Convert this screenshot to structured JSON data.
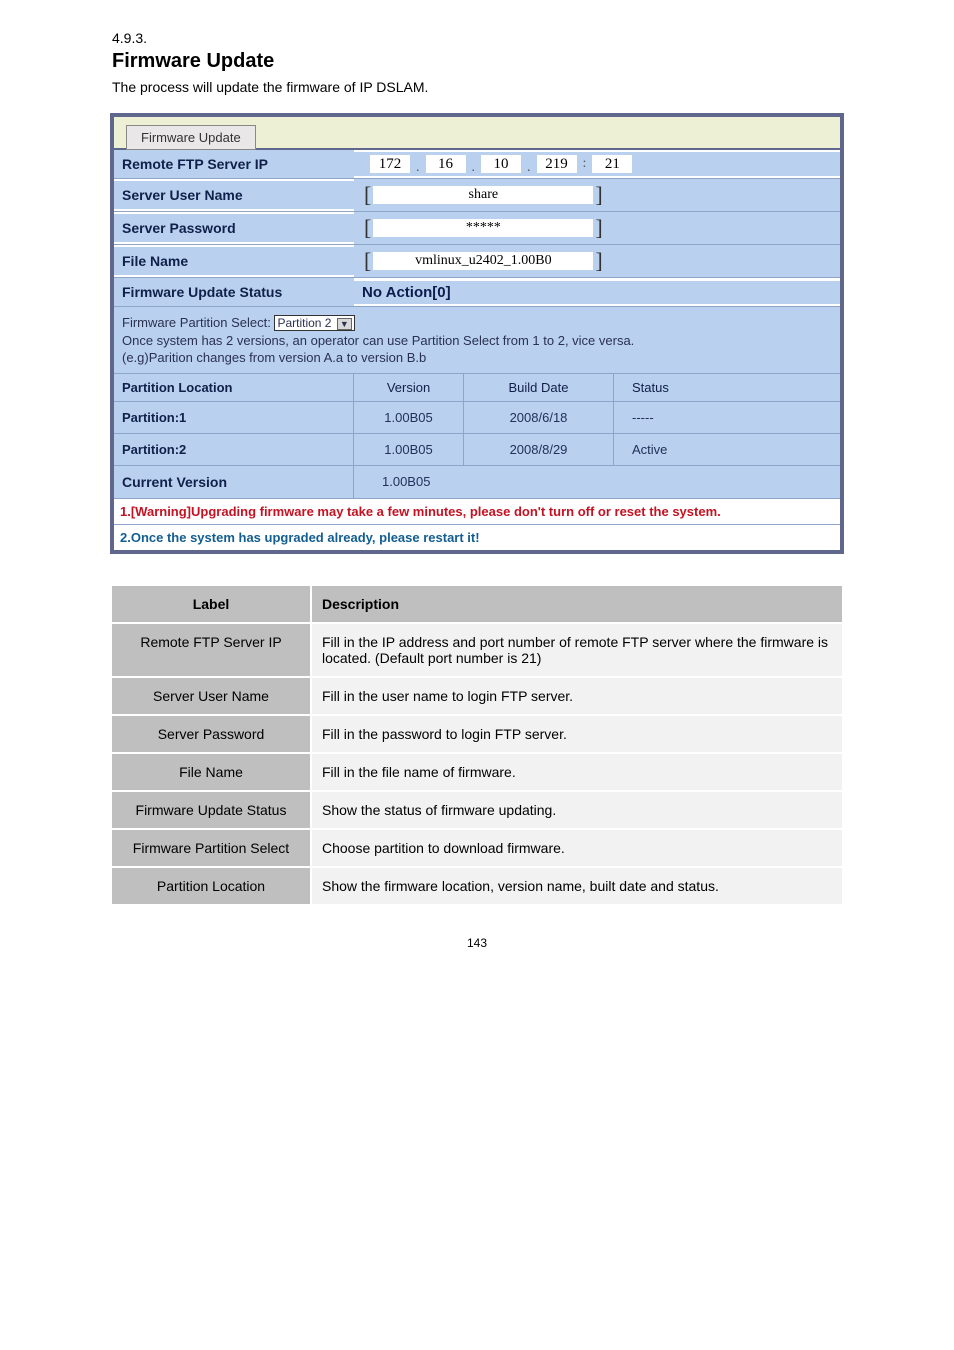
{
  "page_prefix": "4.9.3.",
  "page_title": "Firmware Update",
  "intro": "The process will update the firmware of IP DSLAM.",
  "screenshot": {
    "tab_label": "Firmware Update",
    "rows": {
      "ftp_ip_label": "Remote FTP Server IP",
      "ftp_ip_parts": {
        "a": "172",
        "b": "16",
        "c": "10",
        "d": "219",
        "port": "21"
      },
      "user_label": "Server User Name",
      "user_value": "share",
      "pass_label": "Server Password",
      "pass_value": "*****",
      "file_label": "File Name",
      "file_value": "vmlinux_u2402_1.00B0",
      "status_label": "Firmware Update Status",
      "status_value": "No Action[0]"
    },
    "partition_select": {
      "label": "Firmware Partition Select:",
      "value": "Partition 2",
      "help1": "Once system has 2 versions, an operator can use Partition Select from 1 to 2, vice versa.",
      "help2": "(e.g)Parition changes from version A.a to version B.b"
    },
    "table": {
      "header": {
        "loc": "Partition Location",
        "ver": "Version",
        "date": "Build Date",
        "status": "Status"
      },
      "rows": [
        {
          "loc": "Partition:1",
          "ver": "1.00B05",
          "date": "2008/6/18",
          "status": "-----"
        },
        {
          "loc": "Partition:2",
          "ver": "1.00B05",
          "date": "2008/8/29",
          "status": "Active"
        }
      ],
      "current_label": "Current Version",
      "current_value": "1.00B05"
    },
    "warn1": "1.[Warning]Upgrading firmware may take a few minutes, please don't turn off or reset the system.",
    "warn2": "2.Once the system has upgraded already, please restart it!"
  },
  "desc": {
    "header": {
      "label": "Label",
      "desc": "Description"
    },
    "rows": [
      {
        "label": "Remote FTP Server IP",
        "desc": "Fill in the IP address and port number of remote FTP server where the firmware is located. (Default port number is 21)"
      },
      {
        "label": "Server User Name",
        "desc": "Fill in the user name to login FTP server."
      },
      {
        "label": "Server Password",
        "desc": "Fill in the password to login FTP server."
      },
      {
        "label": "File Name",
        "desc": "Fill in the file name of firmware."
      },
      {
        "label": "Firmware Update Status",
        "desc": "Show the status of firmware updating."
      },
      {
        "label": "Firmware Partition Select",
        "desc": "Choose partition to download firmware."
      },
      {
        "label": "Partition Location",
        "desc": "Show the firmware location, version name, built date and status."
      }
    ]
  },
  "footer": "143"
}
